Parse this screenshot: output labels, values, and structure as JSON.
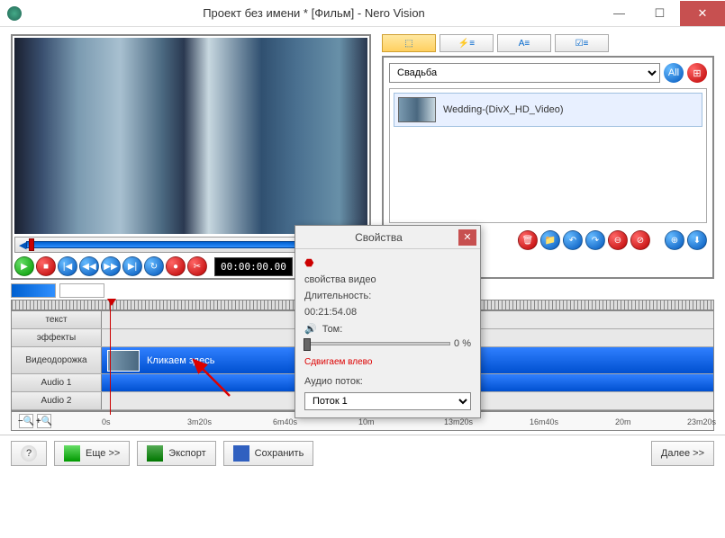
{
  "window": {
    "title": "Проект без имени * [Фильм] - Nero Vision"
  },
  "preview": {
    "timecode": "00:00:00.00"
  },
  "media": {
    "category": "Свадьба",
    "item_name": "Wedding-(DivX_HD_Video)"
  },
  "properties": {
    "title": "Свойства",
    "section": "свойства видео",
    "duration_label": "Длительность:",
    "duration_value": "00:21:54.08",
    "volume_label": "Том:",
    "volume_value": "0 %",
    "hint": "Сдвигаем влево",
    "audio_label": "Аудио поток:",
    "audio_value": "Поток 1"
  },
  "timeline": {
    "tracks": {
      "text": "текст",
      "effects": "эффекты",
      "video": "Видеодорожка",
      "audio1": "Audio 1",
      "audio2": "Audio 2"
    },
    "clip_hint": "Кликаем здесь",
    "marks": [
      "0s",
      "3m20s",
      "6m40s",
      "10m",
      "13m20s",
      "16m40s",
      "20m",
      "23m20s"
    ]
  },
  "bottom": {
    "more": "Еще >>",
    "export": "Экспорт",
    "save": "Сохранить",
    "next": "Далее >>"
  }
}
